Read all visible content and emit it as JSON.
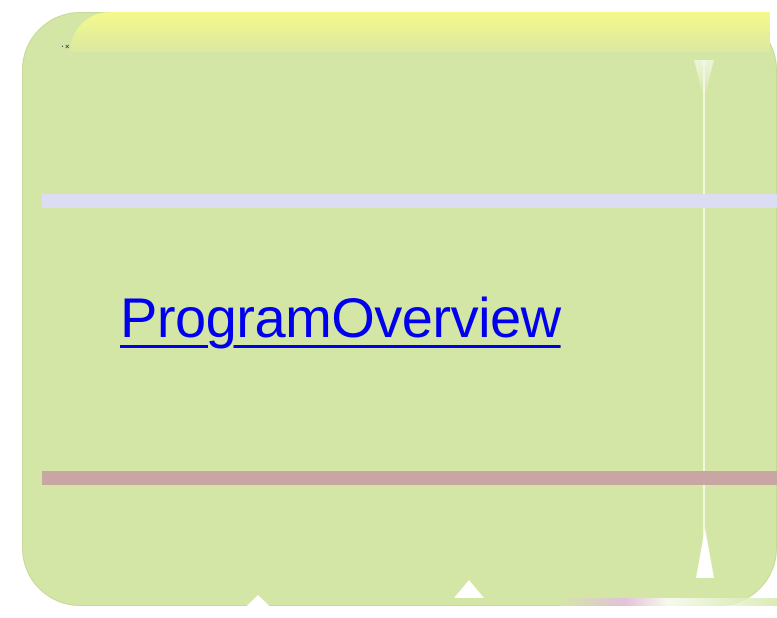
{
  "slide": {
    "link_text": "ProgramOverview"
  },
  "colors": {
    "panel": "#d4e6a6",
    "band_top": "#dcdcf2",
    "band_bottom": "#c8a6a4",
    "link": "#0000ee"
  }
}
